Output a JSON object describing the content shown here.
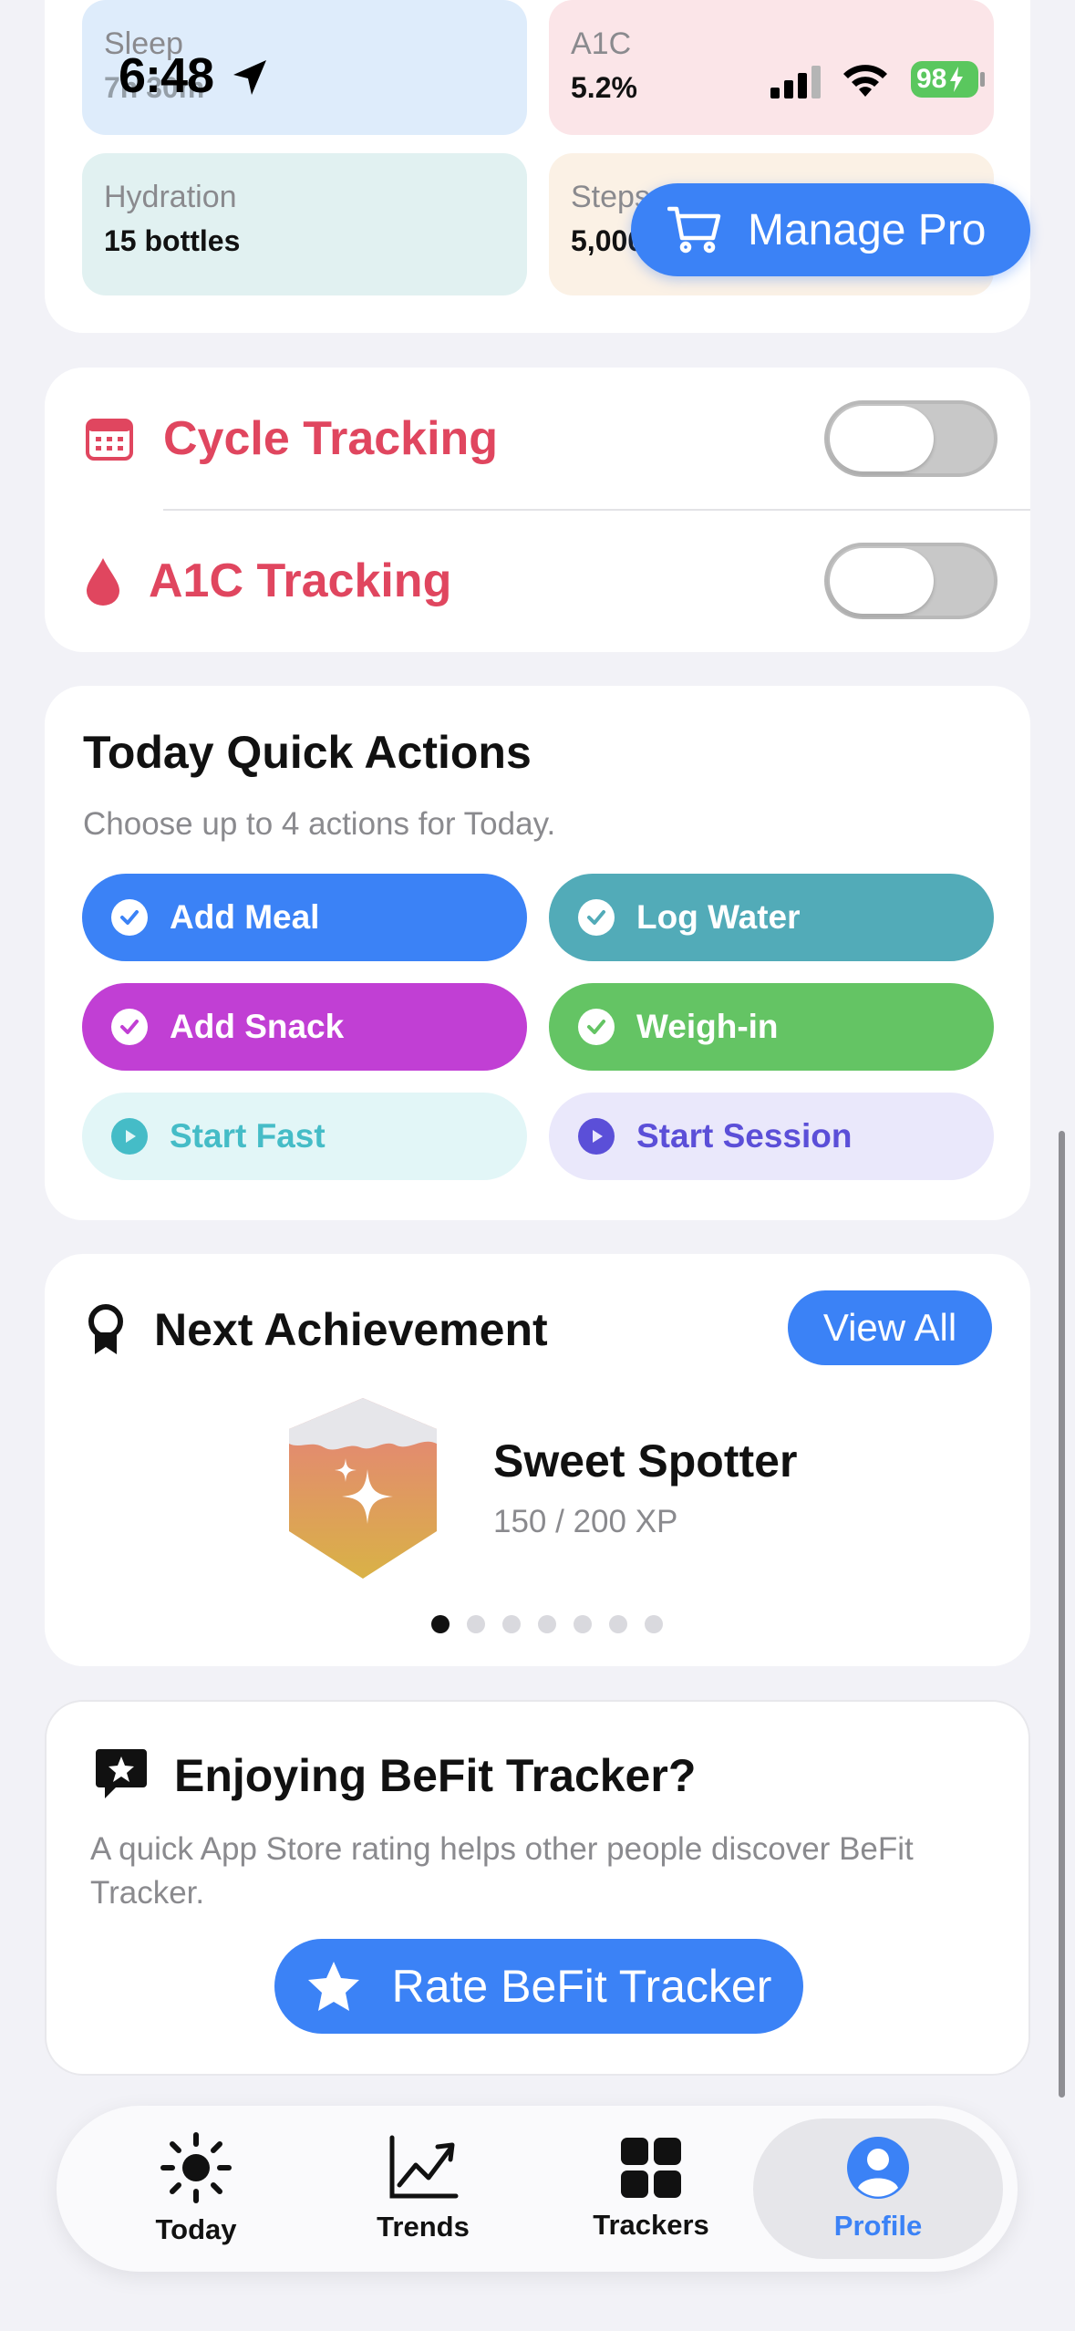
{
  "status_bar": {
    "time": "6:48",
    "battery": "98"
  },
  "metrics": [
    {
      "label": "Sleep",
      "value": "7h 30m",
      "bg": "#deecfb"
    },
    {
      "label": "A1C",
      "value": "5.2%",
      "bg": "#fbe5e8"
    },
    {
      "label": "Hydration",
      "value": "15 bottles",
      "bg": "#e1f1f1"
    },
    {
      "label": "Steps",
      "value": "5,000",
      "bg": "#fbf1e5"
    }
  ],
  "manage_pro": {
    "label": "Manage Pro"
  },
  "toggles": {
    "cycle": {
      "label": "Cycle Tracking",
      "on": false
    },
    "a1c": {
      "label": "A1C Tracking",
      "on": false
    }
  },
  "quick_actions": {
    "title": "Today Quick Actions",
    "subtitle": "Choose up to 4 actions for Today.",
    "actions": [
      {
        "label": "Add Meal",
        "selected": true,
        "color": "#3b82f6"
      },
      {
        "label": "Log Water",
        "selected": true,
        "color": "#52abb8"
      },
      {
        "label": "Add Snack",
        "selected": true,
        "color": "#c13fd4"
      },
      {
        "label": "Weigh-in",
        "selected": true,
        "color": "#64c464"
      },
      {
        "label": "Start Fast",
        "selected": false,
        "color": "#45bcc7"
      },
      {
        "label": "Start Session",
        "selected": false,
        "color": "#5b4fd8"
      }
    ]
  },
  "achievement": {
    "title": "Next Achievement",
    "view_all": "View All",
    "name": "Sweet Spotter",
    "xp_current": 150,
    "xp_total": 200,
    "xp_text": "150 / 200 XP",
    "page_count": 7,
    "active_page": 0
  },
  "rating": {
    "title": "Enjoying BeFit Tracker?",
    "body": "A quick App Store rating helps other people discover BeFit Tracker.",
    "button": "Rate BeFit Tracker"
  },
  "tabs": [
    {
      "label": "Today",
      "icon": "sun-icon",
      "active": false
    },
    {
      "label": "Trends",
      "icon": "trend-chart-icon",
      "active": false
    },
    {
      "label": "Trackers",
      "icon": "grid-icon",
      "active": false
    },
    {
      "label": "Profile",
      "icon": "person-circle-icon",
      "active": true
    }
  ]
}
